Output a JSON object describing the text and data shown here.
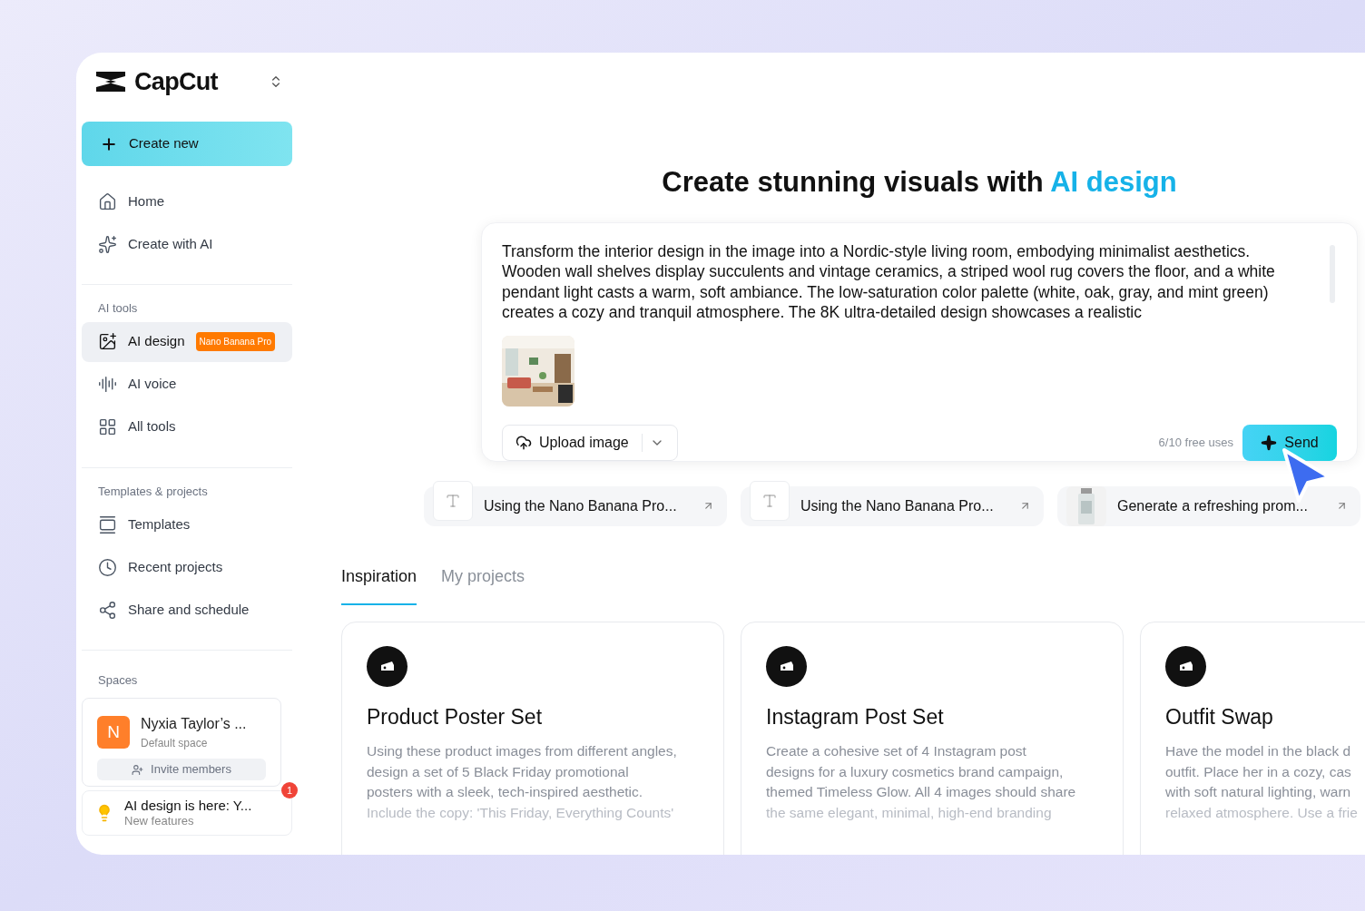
{
  "brand": {
    "name": "CapCut"
  },
  "sidebar": {
    "create_button": "Create new",
    "top_items": [
      {
        "label": "Home",
        "selected": false
      },
      {
        "label": "Create with AI",
        "selected": false
      }
    ],
    "sections": [
      {
        "title": "AI tools",
        "items": [
          {
            "label": "AI design",
            "selected": true,
            "badge": "Nano Banana Pro"
          },
          {
            "label": "AI voice",
            "selected": false
          },
          {
            "label": "All tools",
            "selected": false
          }
        ]
      },
      {
        "title": "Templates & projects",
        "items": [
          {
            "label": "Templates",
            "selected": false
          },
          {
            "label": "Recent projects",
            "selected": false
          },
          {
            "label": "Share and schedule",
            "selected": false
          }
        ]
      }
    ],
    "spaces": {
      "title": "Spaces",
      "avatar": "N",
      "name": "Nyxia Taylor’s ...",
      "subtitle": "Default space",
      "invite": "Invite members"
    },
    "notification": {
      "title": "AI design is here: Y...",
      "subtitle": "New features",
      "count": "1"
    }
  },
  "main": {
    "heading": "Create stunning visuals with",
    "heading_accent": "AI design",
    "prompt": {
      "text": "Transform the interior design in the image into a Nordic-style living room, embodying minimalist aesthetics. Wooden wall shelves display succulents and vintage ceramics, a striped wool rug covers the floor, and a white pendant light casts a warm, soft ambiance. The low-saturation color palette (white, oak, gray, and mint green) creates a cozy and tranquil atmosphere. The 8K ultra-detailed design showcases a realistic",
      "upload": "Upload image",
      "uses": "6/10 free uses",
      "send": "Send"
    },
    "suggestions": [
      {
        "kind": "text",
        "text": "Using the Nano Banana Pro..."
      },
      {
        "kind": "text",
        "text": "Using the Nano Banana Pro..."
      },
      {
        "kind": "picture",
        "text": "Generate a refreshing prom..."
      }
    ],
    "tabs": [
      {
        "label": "Inspiration",
        "selected": true
      },
      {
        "label": "My projects",
        "selected": false
      }
    ],
    "cards": [
      {
        "title": "Product Poster Set",
        "lines": [
          "Using these product images from different angles,",
          "design a set of 5 Black Friday promotional",
          "posters with a sleek, tech-inspired aesthetic.",
          "Include the copy: 'This Friday, Everything Counts'"
        ]
      },
      {
        "title": "Instagram Post Set",
        "lines": [
          "Create a cohesive set of 4 Instagram post",
          "designs for a luxury cosmetics brand campaign,",
          "themed Timeless Glow. All 4 images should share",
          "the same elegant, minimal, high-end branding"
        ]
      },
      {
        "title": "Outfit Swap",
        "lines": [
          "Have the model in the black d",
          "outfit. Place her in a cozy, cas",
          "with soft natural lighting, warn",
          "relaxed atmosphere. Use a frie"
        ]
      }
    ]
  }
}
